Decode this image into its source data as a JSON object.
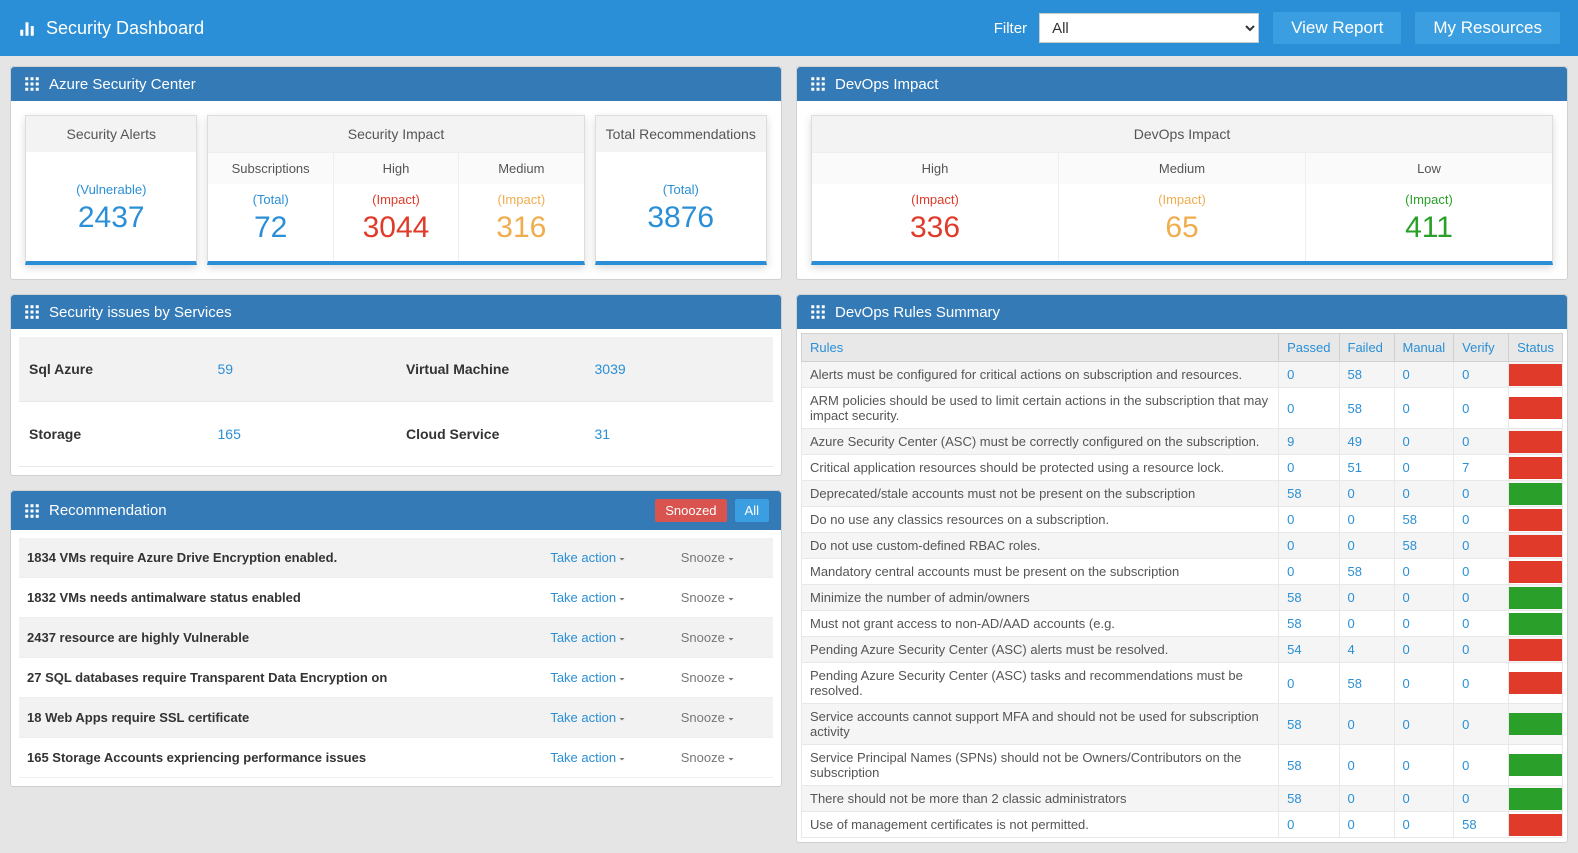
{
  "header": {
    "title": "Security Dashboard",
    "filter_label": "Filter",
    "filter_value": "All",
    "view_report": "View Report",
    "my_resources": "My Resources"
  },
  "azure_panel": {
    "title": "Azure Security Center",
    "alerts": {
      "title": "Security Alerts",
      "label": "(Vulnerable)",
      "value": "2437"
    },
    "impact": {
      "title": "Security Impact",
      "subs": {
        "title": "Subscriptions",
        "label": "(Total)",
        "value": "72"
      },
      "high": {
        "title": "High",
        "label": "(Impact)",
        "value": "3044"
      },
      "medium": {
        "title": "Medium",
        "label": "(Impact)",
        "value": "316"
      }
    },
    "recs": {
      "title": "Total Recommendations",
      "label": "(Total)",
      "value": "3876"
    }
  },
  "devops_panel": {
    "title": "DevOps Impact",
    "impact_title": "DevOps Impact",
    "high": {
      "title": "High",
      "label": "(Impact)",
      "value": "336"
    },
    "medium": {
      "title": "Medium",
      "label": "(Impact)",
      "value": "65"
    },
    "low": {
      "title": "Low",
      "label": "(Impact)",
      "value": "411"
    }
  },
  "services_panel": {
    "title": "Security issues by Services",
    "rows": [
      {
        "n1": "Sql Azure",
        "v1": "59",
        "n2": "Virtual Machine",
        "v2": "3039"
      },
      {
        "n1": "Storage",
        "v1": "165",
        "n2": "Cloud Service",
        "v2": "31"
      }
    ]
  },
  "rec_panel": {
    "title": "Recommendation",
    "snoozed": "Snoozed",
    "all": "All",
    "take_action": "Take action",
    "snooze": "Snooze",
    "items": [
      "1834 VMs require Azure Drive Encryption enabled.",
      "1832 VMs needs antimalware status enabled",
      "2437 resource are highly Vulnerable",
      "27 SQL databases require Transparent Data Encryption on",
      "18 Web Apps require SSL certificate",
      "165 Storage Accounts expriencing performance issues"
    ]
  },
  "rules_panel": {
    "title": "DevOps Rules Summary",
    "headers": {
      "rules": "Rules",
      "passed": "Passed",
      "failed": "Failed",
      "manual": "Manual",
      "verify": "Verify",
      "status": "Status"
    },
    "rows": [
      {
        "rule": "Alerts must be configured for critical actions on subscription and resources.",
        "passed": "0",
        "failed": "58",
        "manual": "0",
        "verify": "0",
        "status": "red"
      },
      {
        "rule": "ARM policies should be used to limit certain actions in the subscription that may impact security.",
        "passed": "0",
        "failed": "58",
        "manual": "0",
        "verify": "0",
        "status": "red"
      },
      {
        "rule": "Azure Security Center (ASC) must be correctly configured on the subscription.",
        "passed": "9",
        "failed": "49",
        "manual": "0",
        "verify": "0",
        "status": "red"
      },
      {
        "rule": "Critical application resources should be protected using a resource lock.",
        "passed": "0",
        "failed": "51",
        "manual": "0",
        "verify": "7",
        "status": "red"
      },
      {
        "rule": "Deprecated/stale accounts must not be present on the subscription",
        "passed": "58",
        "failed": "0",
        "manual": "0",
        "verify": "0",
        "status": "green"
      },
      {
        "rule": "Do no use any classics resources on a subscription.",
        "passed": "0",
        "failed": "0",
        "manual": "58",
        "verify": "0",
        "status": "red"
      },
      {
        "rule": "Do not use custom-defined RBAC roles.",
        "passed": "0",
        "failed": "0",
        "manual": "58",
        "verify": "0",
        "status": "red"
      },
      {
        "rule": "Mandatory central accounts must be present on the subscription",
        "passed": "0",
        "failed": "58",
        "manual": "0",
        "verify": "0",
        "status": "red"
      },
      {
        "rule": "Minimize the number of admin/owners",
        "passed": "58",
        "failed": "0",
        "manual": "0",
        "verify": "0",
        "status": "green"
      },
      {
        "rule": "Must not grant access to non-AD/AAD accounts (e.g.",
        "passed": "58",
        "failed": "0",
        "manual": "0",
        "verify": "0",
        "status": "green"
      },
      {
        "rule": "Pending Azure Security Center (ASC) alerts must be resolved.",
        "passed": "54",
        "failed": "4",
        "manual": "0",
        "verify": "0",
        "status": "red"
      },
      {
        "rule": "Pending Azure Security Center (ASC) tasks and recommendations must be resolved.",
        "passed": "0",
        "failed": "58",
        "manual": "0",
        "verify": "0",
        "status": "red"
      },
      {
        "rule": "Service accounts cannot support MFA and should not be used for subscription activity",
        "passed": "58",
        "failed": "0",
        "manual": "0",
        "verify": "0",
        "status": "green"
      },
      {
        "rule": "Service Principal Names (SPNs) should not be Owners/Contributors on the subscription",
        "passed": "58",
        "failed": "0",
        "manual": "0",
        "verify": "0",
        "status": "green"
      },
      {
        "rule": "There should not be more than 2 classic administrators",
        "passed": "58",
        "failed": "0",
        "manual": "0",
        "verify": "0",
        "status": "green"
      },
      {
        "rule": "Use of management certificates is not permitted.",
        "passed": "0",
        "failed": "0",
        "manual": "0",
        "verify": "58",
        "status": "red"
      }
    ]
  }
}
